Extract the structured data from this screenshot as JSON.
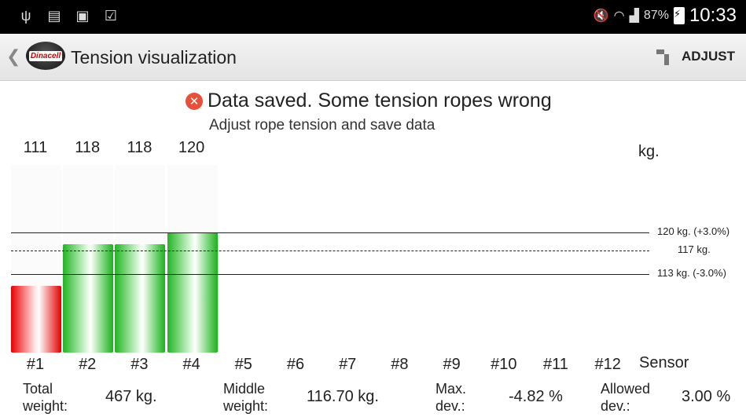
{
  "status_bar": {
    "icons": [
      "usb-icon",
      "sim-missing-icon",
      "image-icon",
      "clipboard-check-icon"
    ],
    "battery_percent": "87%",
    "time": "10:33"
  },
  "action_bar": {
    "logo_text": "Dinacell",
    "title": "Tension visualization",
    "adjust_label": "ADJUST"
  },
  "message": {
    "title": "Data saved. Some tension ropes wrong",
    "subtitle": "Adjust rope tension and save data"
  },
  "chart_data": {
    "type": "bar",
    "categories": [
      "#1",
      "#2",
      "#3",
      "#4",
      "#5",
      "#6",
      "#7",
      "#8",
      "#9",
      "#10",
      "#11",
      "#12"
    ],
    "values": [
      111,
      118,
      118,
      120
    ],
    "value_labels": [
      "111",
      "118",
      "118",
      "120"
    ],
    "bar_status": [
      "out-of-range",
      "ok",
      "ok",
      "ok"
    ],
    "colors": {
      "out_of_range": "#e70000",
      "ok": "#22b422"
    },
    "unit": "kg.",
    "xlabel": "Sensor",
    "reference_lines": [
      {
        "value": 120,
        "label": "120 kg. (+3.0%)",
        "style": "solid"
      },
      {
        "value": 117,
        "label": "117 kg.",
        "style": "dotted"
      },
      {
        "value": 113,
        "label": "113 kg. (-3.0%)",
        "style": "solid"
      }
    ]
  },
  "stats": {
    "total_weight_label_1": "Total",
    "total_weight_label_2": "weight:",
    "total_weight_value": "467 kg.",
    "middle_weight_label_1": "Middle",
    "middle_weight_label_2": "weight:",
    "middle_weight_value": "116.70 kg.",
    "max_dev_label_1": "Max.",
    "max_dev_label_2": "dev.:",
    "max_dev_value": "-4.82 %",
    "allowed_dev_label_1": "Allowed",
    "allowed_dev_label_2": "dev.:",
    "allowed_dev_value": "3.00 %"
  }
}
